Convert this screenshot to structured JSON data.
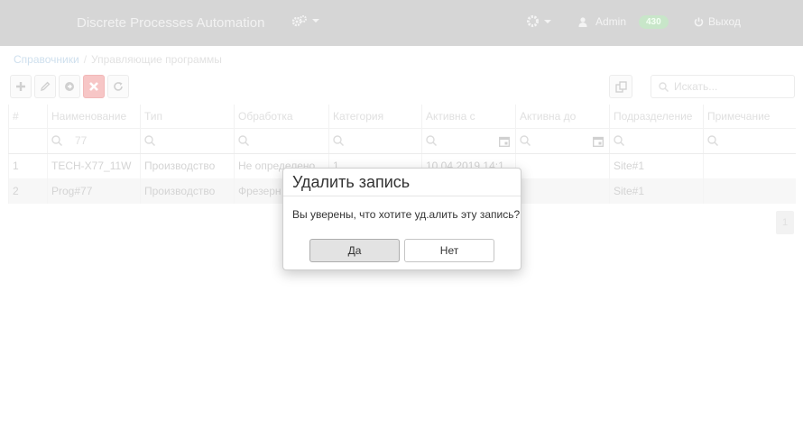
{
  "app": {
    "title": "Discrete Processes Automation"
  },
  "nav": {
    "user": "Admin",
    "badge": "430",
    "logout": "Выход"
  },
  "breadcrumb": {
    "root": "Справочники",
    "current": "Управляющие программы"
  },
  "search": {
    "placeholder": "Искать..."
  },
  "table": {
    "headers": [
      "#",
      "Наименование",
      "Тип",
      "Обработка",
      "Категория",
      "Активна с",
      "Активна до",
      "Подразделение",
      "Примечание"
    ],
    "filter_name": "77",
    "rows": [
      [
        "1",
        "TECH-X77_11W",
        "Производство",
        "Не определено",
        "1",
        "10.04.2019 14:1",
        "",
        "Site#1",
        ""
      ],
      [
        "2",
        "Prog#77",
        "Производство",
        "Фрезерн",
        "",
        "",
        "",
        "Site#1",
        ""
      ]
    ]
  },
  "pager": {
    "page": "1"
  },
  "dialog": {
    "title": "Удалить запись",
    "message": "Вы уверены, что хотите уд.алить эту запись?",
    "yes": "Да",
    "no": "Нет"
  },
  "colors": {
    "navbar": "#d6d6d6",
    "danger": "#f7c6c6",
    "badge": "#c8e6c9"
  }
}
